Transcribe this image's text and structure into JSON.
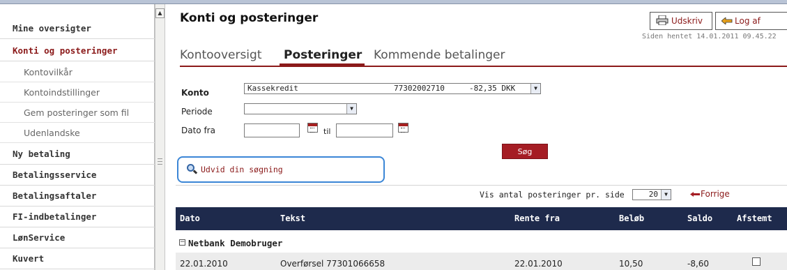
{
  "sidebar": {
    "items": [
      {
        "label": "Mine oversigter",
        "active": false
      },
      {
        "label": "Konti og posteringer",
        "active": true
      },
      {
        "label": "Ny betaling",
        "active": false
      },
      {
        "label": "Betalingsservice",
        "active": false
      },
      {
        "label": "Betalingsaftaler",
        "active": false
      },
      {
        "label": "FI-indbetalinger",
        "active": false
      },
      {
        "label": "LønService",
        "active": false
      },
      {
        "label": "Kuvert",
        "active": false
      }
    ],
    "subitems": [
      "Kontovilkår",
      "Kontoindstillinger",
      "Gem posteringer som fil",
      "Udenlandske"
    ]
  },
  "header": {
    "title": "Konti og posteringer",
    "print_label": "Udskriv",
    "logout_label": "Log af",
    "timestamp": "Siden hentet 14.01.2011 09.45.22"
  },
  "tabs": [
    {
      "label": "Kontooversigt",
      "active": false
    },
    {
      "label": "Posteringer",
      "active": true
    },
    {
      "label": "Kommende betalinger",
      "active": false
    }
  ],
  "form": {
    "account_label": "Konto",
    "account_name": "Kassekredit",
    "account_number": "77302002710",
    "account_balance": "-82,35 DKK",
    "period_label": "Periode",
    "period_value": "",
    "date_from_label": "Dato fra",
    "date_to_label": "til",
    "search_label": "Søg",
    "expand_search_label": "Udvid din søgning"
  },
  "pager": {
    "per_page_label": "Vis antal posteringer pr. side",
    "per_page_value": "20",
    "prev_label": "Forrige"
  },
  "table": {
    "headers": [
      "Dato",
      "Tekst",
      "Rente fra",
      "Beløb",
      "Saldo",
      "Afstemt"
    ],
    "group_label": "Netbank Demobruger",
    "rows": [
      {
        "dato": "22.01.2010",
        "tekst": "Overførsel 77301066658",
        "rente_fra": "22.01.2010",
        "beloeb": "10,50",
        "saldo": "-8,60",
        "afstemt": false
      }
    ]
  },
  "icons": {
    "print": "printer-icon",
    "logout": "arrow-left-icon",
    "calendar": "calendar-icon",
    "search": "magnifier-icon",
    "prev": "arrow-left-icon",
    "dropdown": "chevron-down-icon"
  },
  "colors": {
    "brand": "#8b1a1a",
    "search_button": "#a51d24",
    "table_header": "#1e2a4c",
    "highlight_border": "#3b86d6"
  }
}
